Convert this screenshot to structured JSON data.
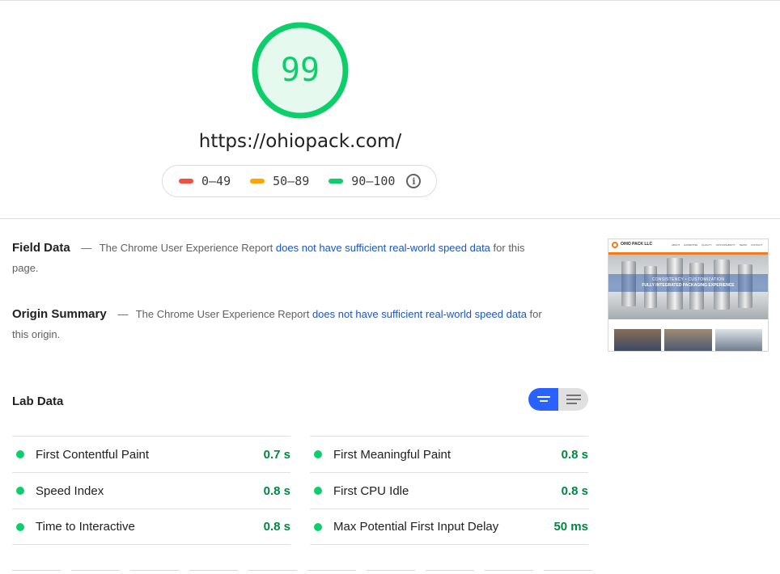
{
  "report": {
    "score": "99",
    "url": "https://ohiopack.com/"
  },
  "legend": [
    {
      "label": "0–49",
      "color": "#f4503f"
    },
    {
      "label": "50–89",
      "color": "#ffa400"
    },
    {
      "label": "90–100",
      "color": "#0cce6b"
    }
  ],
  "field_data": {
    "title": "Field Data",
    "text_before": "The Chrome User Experience Report",
    "link": "does not have sufficient real-world speed data",
    "text_after": "for this page."
  },
  "origin_summary": {
    "title": "Origin Summary",
    "text_before": "The Chrome User Experience Report",
    "link": "does not have sufficient real-world speed data",
    "text_after": "for this origin."
  },
  "thumbnail": {
    "logo": "OHIO PACK LLC",
    "nav": [
      "ABOUT",
      "EXPERTISE",
      "QUALITY",
      "SUSTAINABILITY",
      "NEWS",
      "CONTACT"
    ],
    "banner_line1": "CONSISTENCY • CUSTOMIZATION",
    "banner_line2": "FULLY INTEGRATED PACKAGING EXPERIENCE"
  },
  "lab_data": {
    "title": "Lab Data",
    "left": [
      {
        "label": "First Contentful Paint",
        "value": "0.7 s"
      },
      {
        "label": "Speed Index",
        "value": "0.8 s"
      },
      {
        "label": "Time to Interactive",
        "value": "0.8 s"
      }
    ],
    "right": [
      {
        "label": "First Meaningful Paint",
        "value": "0.8 s"
      },
      {
        "label": "First CPU Idle",
        "value": "0.8 s"
      },
      {
        "label": "Max Potential First Input Delay",
        "value": "50 ms"
      }
    ]
  },
  "colors": {
    "pass": "#0cce6b",
    "link": "#1a56c8",
    "toggle_active": "#2962ff"
  }
}
